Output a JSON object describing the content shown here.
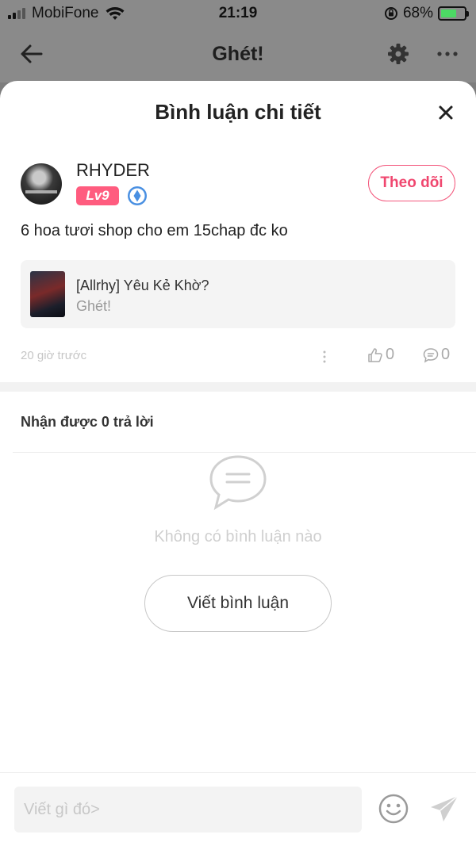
{
  "status_bar": {
    "carrier": "MobiFone",
    "time": "21:19",
    "battery_percent": "68%",
    "icons": [
      "signal-icon",
      "wifi-icon",
      "orientation-lock-icon",
      "battery-icon"
    ],
    "battery_level": 0.68
  },
  "app_bar": {
    "title": "Ghét!",
    "icons": [
      "back-arrow-icon",
      "gear-icon",
      "more-icon"
    ]
  },
  "sheet": {
    "title": "Bình luận chi tiết",
    "close_icon": "close-icon"
  },
  "comment": {
    "username": "RHYDER",
    "level": "Lv9",
    "follow_label": "Theo dõi",
    "text": "6 hoa tươi shop cho em 15chap đc ko",
    "reference": {
      "title": "[Allrhy] Yêu Kẻ Khờ?",
      "subtitle": "Ghét!"
    },
    "time": "20 giờ trước",
    "likes": "0",
    "replies": "0"
  },
  "replies_section": {
    "heading": "Nhận được 0 trả lời",
    "empty_text": "Không có bình luận nào",
    "write_button": "Viết bình luận"
  },
  "composer": {
    "placeholder": "Viết gì đó>",
    "icons": [
      "emoji-icon",
      "send-icon"
    ]
  },
  "colors": {
    "accent": "#f0476f",
    "level_badge": "#ff5c7f",
    "battery_fill": "#4cd964",
    "overlay": "#8a8a8a"
  }
}
